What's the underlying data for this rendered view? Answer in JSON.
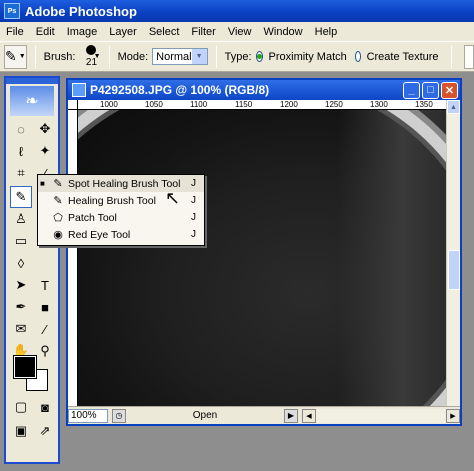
{
  "app": {
    "title": "Adobe Photoshop",
    "icon": "photoshop-icon"
  },
  "menu": [
    "File",
    "Edit",
    "Image",
    "Layer",
    "Select",
    "Filter",
    "View",
    "Window",
    "Help"
  ],
  "options": {
    "brush_label": "Brush:",
    "brush_size": "21",
    "mode_label": "Mode:",
    "mode_value": "Normal",
    "type_label": "Type:",
    "proximity_label": "Proximity Match",
    "proximity_selected": true,
    "create_texture_label": "Create Texture",
    "create_texture_selected": false
  },
  "document": {
    "title": "P4292508.JPG @ 100% (RGB/8)",
    "ruler_labels": [
      "1000",
      "1050",
      "1100",
      "1150",
      "1200",
      "1250",
      "1300",
      "1350"
    ],
    "zoom": "100%",
    "status": "Open"
  },
  "flyout": {
    "items": [
      {
        "label": "Spot Healing Brush Tool",
        "key": "J",
        "icon": "spot-healing-icon",
        "selected": true
      },
      {
        "label": "Healing Brush Tool",
        "key": "J",
        "icon": "healing-brush-icon",
        "selected": false
      },
      {
        "label": "Patch Tool",
        "key": "J",
        "icon": "patch-icon",
        "selected": false
      },
      {
        "label": "Red Eye Tool",
        "key": "J",
        "icon": "red-eye-icon",
        "selected": false
      }
    ]
  },
  "colors": {
    "titlebar": "#0a3fc0",
    "chrome": "#ece9d8",
    "workspace": "#8e8e8e",
    "foreground": "#000000",
    "background": "#ffffff"
  }
}
